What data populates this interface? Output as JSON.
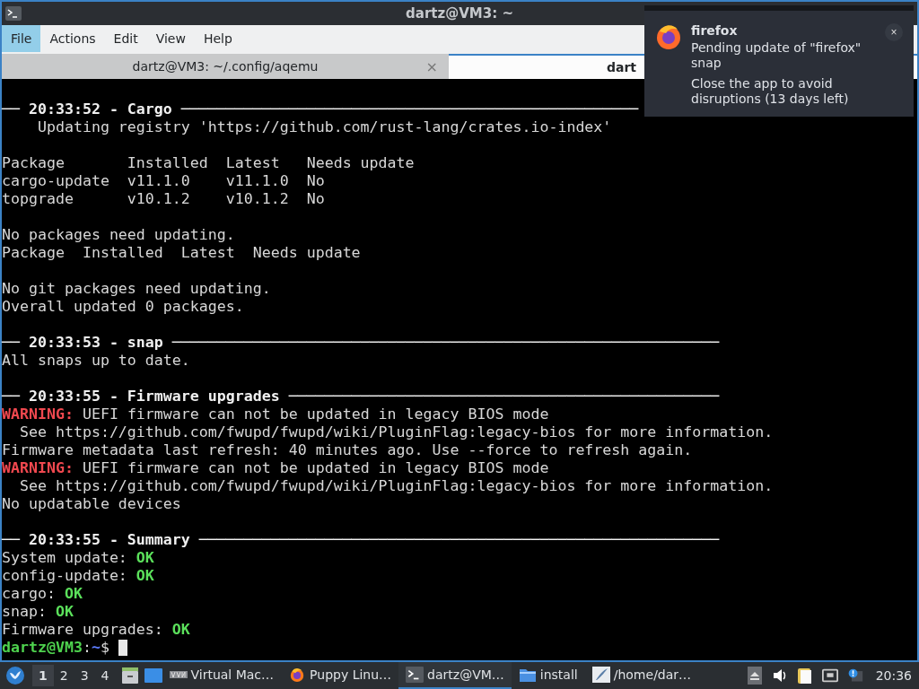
{
  "window": {
    "title": "dartz@VM3: ~"
  },
  "menu": [
    {
      "label": "File",
      "selected": true
    },
    {
      "label": "Actions",
      "selected": false
    },
    {
      "label": "Edit",
      "selected": false
    },
    {
      "label": "View",
      "selected": false
    },
    {
      "label": "Help",
      "selected": false
    }
  ],
  "tabs": [
    {
      "label": "dartz@VM3: ~/.config/aqemu",
      "selected": false,
      "close": "×"
    },
    {
      "label": "dart",
      "selected": true
    }
  ],
  "terminal": {
    "lines": [
      {
        "kind": "text",
        "segments": [
          {
            "text": "── 20:33:52 - Cargo ───────────────────────────────────────────────────",
            "kind": "bold"
          }
        ]
      },
      {
        "kind": "text",
        "segments": [
          {
            "text": "    Updating registry 'https://github.com/rust-lang/crates.io-index'",
            "kind": "plain"
          }
        ]
      },
      {
        "kind": "blank"
      },
      {
        "kind": "text",
        "segments": [
          {
            "text": "Package       Installed  Latest   Needs update",
            "kind": "plain"
          }
        ]
      },
      {
        "kind": "text",
        "segments": [
          {
            "text": "cargo-update  v11.1.0    v11.1.0  No",
            "kind": "plain"
          }
        ]
      },
      {
        "kind": "text",
        "segments": [
          {
            "text": "topgrade      v10.1.2    v10.1.2  No",
            "kind": "plain"
          }
        ]
      },
      {
        "kind": "blank"
      },
      {
        "kind": "text",
        "segments": [
          {
            "text": "No packages need updating.",
            "kind": "plain"
          }
        ]
      },
      {
        "kind": "text",
        "segments": [
          {
            "text": "Package  Installed  Latest  Needs update",
            "kind": "plain"
          }
        ]
      },
      {
        "kind": "blank"
      },
      {
        "kind": "text",
        "segments": [
          {
            "text": "No git packages need updating.",
            "kind": "plain"
          }
        ]
      },
      {
        "kind": "text",
        "segments": [
          {
            "text": "Overall updated 0 packages.",
            "kind": "plain"
          }
        ]
      },
      {
        "kind": "blank"
      },
      {
        "kind": "text",
        "segments": [
          {
            "text": "── 20:33:53 - snap ─────────────────────────────────────────────────────────────",
            "kind": "bold"
          }
        ]
      },
      {
        "kind": "text",
        "segments": [
          {
            "text": "All snaps up to date.",
            "kind": "plain"
          }
        ]
      },
      {
        "kind": "blank"
      },
      {
        "kind": "text",
        "segments": [
          {
            "text": "── 20:33:55 - Firmware upgrades ────────────────────────────────────────────────",
            "kind": "bold"
          }
        ]
      },
      {
        "kind": "text",
        "segments": [
          {
            "text": "WARNING:",
            "kind": "warning"
          },
          {
            "text": " UEFI firmware can not be updated in legacy BIOS mode",
            "kind": "plain"
          }
        ]
      },
      {
        "kind": "text",
        "segments": [
          {
            "text": "  See https://github.com/fwupd/fwupd/wiki/PluginFlag:legacy-bios for more information.",
            "kind": "plain"
          }
        ]
      },
      {
        "kind": "text",
        "segments": [
          {
            "text": "Firmware metadata last refresh: 40 minutes ago. Use --force to refresh again.",
            "kind": "plain"
          }
        ]
      },
      {
        "kind": "text",
        "segments": [
          {
            "text": "WARNING:",
            "kind": "warning"
          },
          {
            "text": " UEFI firmware can not be updated in legacy BIOS mode",
            "kind": "plain"
          }
        ]
      },
      {
        "kind": "text",
        "segments": [
          {
            "text": "  See https://github.com/fwupd/fwupd/wiki/PluginFlag:legacy-bios for more information.",
            "kind": "plain"
          }
        ]
      },
      {
        "kind": "text",
        "segments": [
          {
            "text": "No updatable devices",
            "kind": "plain"
          }
        ]
      },
      {
        "kind": "blank"
      },
      {
        "kind": "text",
        "segments": [
          {
            "text": "── 20:33:55 - Summary ──────────────────────────────────────────────────────────",
            "kind": "bold"
          }
        ]
      },
      {
        "kind": "text",
        "segments": [
          {
            "text": "System update: ",
            "kind": "plain"
          },
          {
            "text": "OK",
            "kind": "ok"
          }
        ]
      },
      {
        "kind": "text",
        "segments": [
          {
            "text": "config-update: ",
            "kind": "plain"
          },
          {
            "text": "OK",
            "kind": "ok"
          }
        ]
      },
      {
        "kind": "text",
        "segments": [
          {
            "text": "cargo: ",
            "kind": "plain"
          },
          {
            "text": "OK",
            "kind": "ok"
          }
        ]
      },
      {
        "kind": "text",
        "segments": [
          {
            "text": "snap: ",
            "kind": "plain"
          },
          {
            "text": "OK",
            "kind": "ok"
          }
        ]
      },
      {
        "kind": "text",
        "segments": [
          {
            "text": "Firmware upgrades: ",
            "kind": "plain"
          },
          {
            "text": "OK",
            "kind": "ok"
          }
        ]
      },
      {
        "kind": "prompt",
        "segments": [
          {
            "text": "dartz@VM3",
            "kind": "user"
          },
          {
            "text": ":",
            "kind": "plain"
          },
          {
            "text": "~",
            "kind": "path"
          },
          {
            "text": "$ ",
            "kind": "plain"
          }
        ]
      }
    ]
  },
  "notification": {
    "app": "firefox",
    "close": "×",
    "body": "Pending update of \"firefox\" snap",
    "detail": "Close the app to avoid disruptions (13 days left)"
  },
  "taskbar": {
    "workspaces": [
      {
        "label": "1",
        "selected": true
      },
      {
        "label": "2",
        "selected": false
      },
      {
        "label": "3",
        "selected": false
      },
      {
        "label": "4",
        "selected": false
      }
    ],
    "tasks": [
      {
        "kind": "vm",
        "label": "Virtual Mac…",
        "selected": false
      },
      {
        "kind": "browser",
        "label": "Puppy Linu…",
        "selected": false
      },
      {
        "kind": "terminal",
        "label": "dartz@VM…",
        "selected": true
      },
      {
        "kind": "folder",
        "label": "install",
        "selected": false
      },
      {
        "kind": "editor",
        "label": "/home/dar…",
        "selected": false
      }
    ],
    "clock": "20:36"
  }
}
